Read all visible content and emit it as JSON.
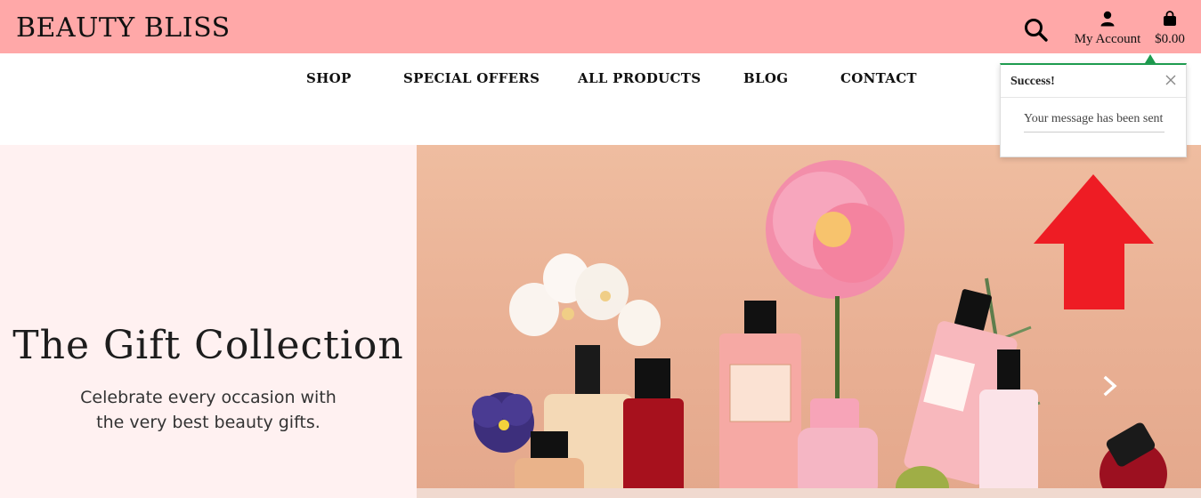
{
  "header": {
    "logo": "BEAUTY BLISS",
    "account_label": "My Account",
    "cart_total": "$0.00"
  },
  "icons": {
    "search": "search-icon",
    "account": "user-icon",
    "cart": "shopping-bag-icon",
    "close": "close-icon",
    "next": "chevron-right-icon",
    "annotation": "arrow-up-icon"
  },
  "nav": {
    "items": [
      {
        "label": "SHOP"
      },
      {
        "label": "SPECIAL OFFERS"
      },
      {
        "label": "ALL PRODUCTS"
      },
      {
        "label": "BLOG"
      },
      {
        "label": "CONTACT"
      }
    ]
  },
  "hero": {
    "title": "The Gift Collection",
    "subtitle": "Celebrate every occasion with the very best beauty gifts."
  },
  "toast": {
    "title": "Success!",
    "message": "Your message has been sent"
  },
  "colors": {
    "topbar": "#ffa8a8",
    "hero_left_bg": "#fff1f1",
    "toast_accent": "#1e9b4f",
    "annotation_arrow": "#ee1c24"
  }
}
